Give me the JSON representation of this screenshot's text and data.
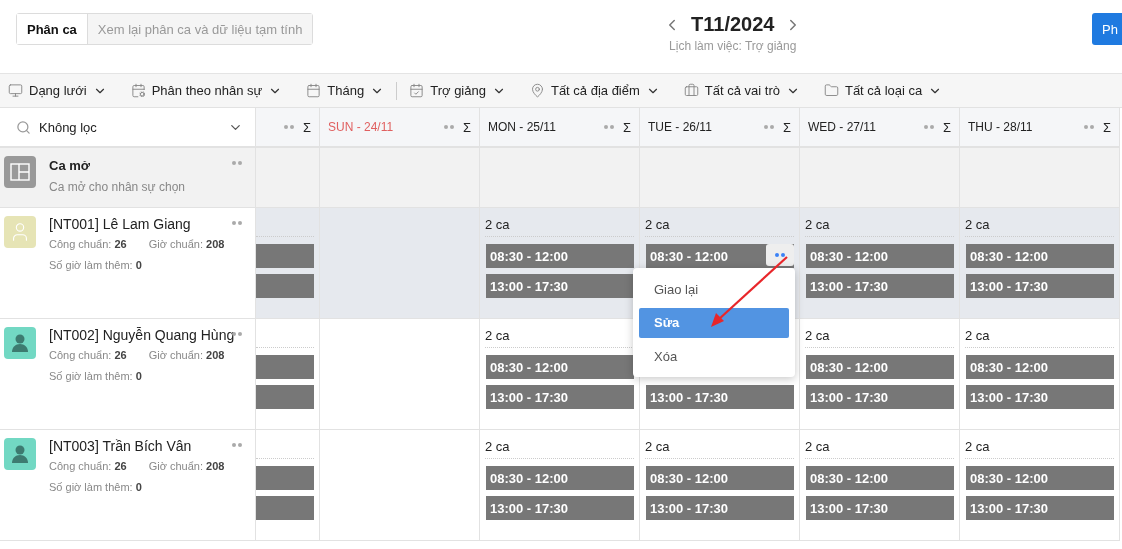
{
  "header": {
    "tabs": [
      {
        "label": "Phân ca",
        "selected": true
      },
      {
        "label": "Xem lại phân ca và dữ liệu tạm tính",
        "selected": false
      }
    ],
    "period": "T11/2024",
    "subtitle": "Lịch làm việc: Trợ giảng",
    "action_button": "Ph"
  },
  "toolbar": [
    {
      "kind": "monitor",
      "label": "Dạng lưới",
      "separator_after": false
    },
    {
      "kind": "calendar-edit",
      "label": "Phân theo nhân sự",
      "separator_after": false
    },
    {
      "kind": "calendar",
      "label": "Tháng",
      "separator_after": true
    },
    {
      "kind": "calendar-check",
      "label": "Trợ giảng",
      "separator_after": false
    },
    {
      "kind": "pin",
      "label": "Tất cả địa điểm",
      "separator_after": false
    },
    {
      "kind": "briefcase",
      "label": "Tất cả vai trò",
      "separator_after": false
    },
    {
      "kind": "folder",
      "label": "Tất cả loại ca",
      "separator_after": false
    }
  ],
  "filter": {
    "label": "Không lọc"
  },
  "columns": [
    {
      "kind": "cut",
      "sum_symbol": "Σ"
    },
    {
      "kind": "day",
      "label": "SUN - 24/11",
      "weekend": true,
      "sum_symbol": "Σ"
    },
    {
      "kind": "day",
      "label": "MON - 25/11",
      "weekend": false,
      "sum_symbol": "Σ"
    },
    {
      "kind": "day",
      "label": "TUE - 26/11",
      "weekend": false,
      "sum_symbol": "Σ"
    },
    {
      "kind": "day",
      "label": "WED - 27/11",
      "weekend": false,
      "sum_symbol": "Σ"
    },
    {
      "kind": "day",
      "label": "THU - 28/11",
      "weekend": false,
      "sum_symbol": "Σ"
    }
  ],
  "open_shift": {
    "title": "Ca mở",
    "subtitle": "Ca mở cho nhân sự chọn"
  },
  "employees": [
    {
      "name": "[NT001] Lê Lam Giang",
      "avatar": {
        "kind": "outline",
        "color": "#e6e4b5"
      },
      "highlighted": true,
      "stats": [
        {
          "label": "Công chuẩn:",
          "value": "26"
        },
        {
          "label": "Giờ chuẩn:",
          "value": "208"
        }
      ],
      "overtime": {
        "label": "Số giờ làm thêm:",
        "value": "0"
      },
      "cells": [
        {
          "kind": "cut",
          "shifts": [
            {
              "kind": "bar"
            },
            {
              "kind": "bar"
            }
          ]
        },
        {
          "kind": "empty"
        },
        {
          "kind": "day",
          "label": "2 ca",
          "shifts": [
            {
              "kind": "time",
              "time": "08:30 - 12:00"
            },
            {
              "kind": "time",
              "time": "13:00 - 17:30"
            }
          ]
        },
        {
          "kind": "day",
          "label": "2 ca",
          "shifts": [
            {
              "kind": "time",
              "time": "08:30 - 12:00",
              "menu_open": true
            },
            {
              "kind": "covered"
            }
          ]
        },
        {
          "kind": "day",
          "label": "2 ca",
          "shifts": [
            {
              "kind": "time",
              "time": "08:30 - 12:00"
            },
            {
              "kind": "time",
              "time": "13:00 - 17:30"
            }
          ]
        },
        {
          "kind": "day",
          "label": "2 ca",
          "shifts": [
            {
              "kind": "time",
              "time": "08:30 - 12:00"
            },
            {
              "kind": "time",
              "time": "13:00 - 17:30"
            }
          ]
        }
      ]
    },
    {
      "name": "[NT002] Nguyễn Quang Hùng",
      "avatar": {
        "kind": "filled",
        "color": "#72d8c3"
      },
      "highlighted": false,
      "stats": [
        {
          "label": "Công chuẩn:",
          "value": "26"
        },
        {
          "label": "Giờ chuẩn:",
          "value": "208"
        }
      ],
      "overtime": {
        "label": "Số giờ làm thêm:",
        "value": "0"
      },
      "cells": [
        {
          "kind": "cut",
          "shifts": [
            {
              "kind": "bar"
            },
            {
              "kind": "bar"
            }
          ]
        },
        {
          "kind": "empty"
        },
        {
          "kind": "day",
          "label": "2 ca",
          "shifts": [
            {
              "kind": "time",
              "time": "08:30 - 12:00"
            },
            {
              "kind": "time",
              "time": "13:00 - 17:30"
            }
          ]
        },
        {
          "kind": "day",
          "shifts": [
            {
              "kind": "covered"
            },
            {
              "kind": "time",
              "time": "13:00 - 17:30"
            }
          ]
        },
        {
          "kind": "day",
          "label": "2 ca",
          "shifts": [
            {
              "kind": "time",
              "time": "08:30 - 12:00"
            },
            {
              "kind": "time",
              "time": "13:00 - 17:30"
            }
          ]
        },
        {
          "kind": "day",
          "label": "2 ca",
          "shifts": [
            {
              "kind": "time",
              "time": "08:30 - 12:00"
            },
            {
              "kind": "time",
              "time": "13:00 - 17:30"
            }
          ]
        }
      ]
    },
    {
      "name": "[NT003] Trần Bích Vân",
      "avatar": {
        "kind": "filled",
        "color": "#72d8c3"
      },
      "highlighted": false,
      "stats": [
        {
          "label": "Công chuẩn:",
          "value": "26"
        },
        {
          "label": "Giờ chuẩn:",
          "value": "208"
        }
      ],
      "overtime": {
        "label": "Số giờ làm thêm:",
        "value": "0"
      },
      "cells": [
        {
          "kind": "cut",
          "shifts": [
            {
              "kind": "bar"
            },
            {
              "kind": "bar"
            }
          ]
        },
        {
          "kind": "empty"
        },
        {
          "kind": "day",
          "label": "2 ca",
          "shifts": [
            {
              "kind": "time",
              "time": "08:30 - 12:00"
            },
            {
              "kind": "time",
              "time": "13:00 - 17:30"
            }
          ]
        },
        {
          "kind": "day",
          "label": "2 ca",
          "shifts": [
            {
              "kind": "time",
              "time": "08:30 - 12:00"
            },
            {
              "kind": "time",
              "time": "13:00 - 17:30"
            }
          ]
        },
        {
          "kind": "day",
          "label": "2 ca",
          "shifts": [
            {
              "kind": "time",
              "time": "08:30 - 12:00"
            },
            {
              "kind": "time",
              "time": "13:00 - 17:30"
            }
          ]
        },
        {
          "kind": "day",
          "label": "2 ca",
          "shifts": [
            {
              "kind": "time",
              "time": "08:30 - 12:00"
            },
            {
              "kind": "time",
              "time": "13:00 - 17:30"
            }
          ]
        }
      ]
    }
  ],
  "shift_menu": {
    "items": [
      {
        "label": "Giao lại",
        "selected": false
      },
      {
        "label": "Sửa",
        "selected": true
      },
      {
        "label": "Xóa",
        "selected": false
      }
    ]
  }
}
